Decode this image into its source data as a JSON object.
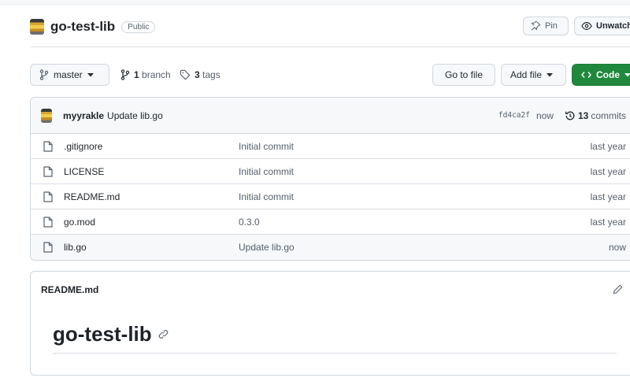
{
  "repo": {
    "name": "go-test-lib",
    "visibility": "Public",
    "pin_label": "Pin",
    "watch_label": "Unwatch"
  },
  "toolbar": {
    "branch": "master",
    "branch_count": "1",
    "branch_label": "branch",
    "tag_count": "3",
    "tag_label": "tags",
    "go_to_file": "Go to file",
    "add_file": "Add file",
    "code": "Code"
  },
  "last_commit": {
    "author": "myyrakle",
    "message": "Update lib.go",
    "sha": "fd4ca2f",
    "time": "now",
    "commit_count": "13",
    "commit_label": "commits"
  },
  "files": [
    {
      "name": ".gitignore",
      "message": "Initial commit",
      "age": "last year"
    },
    {
      "name": "LICENSE",
      "message": "Initial commit",
      "age": "last year"
    },
    {
      "name": "README.md",
      "message": "Initial commit",
      "age": "last year"
    },
    {
      "name": "go.mod",
      "message": "0.3.0",
      "age": "last year"
    },
    {
      "name": "lib.go",
      "message": "Update lib.go",
      "age": "now"
    }
  ],
  "readme": {
    "filename": "README.md",
    "heading": "go-test-lib"
  },
  "icons": [
    "repo-avatar-icon",
    "pin-icon",
    "eye-icon",
    "branch-icon",
    "tag-icon",
    "caret-down-icon",
    "code-icon",
    "history-icon",
    "file-icon",
    "pencil-icon",
    "link-icon"
  ],
  "colors": {
    "accent_green": "#1f883d",
    "border": "#d0d7de",
    "muted": "#57606a"
  }
}
